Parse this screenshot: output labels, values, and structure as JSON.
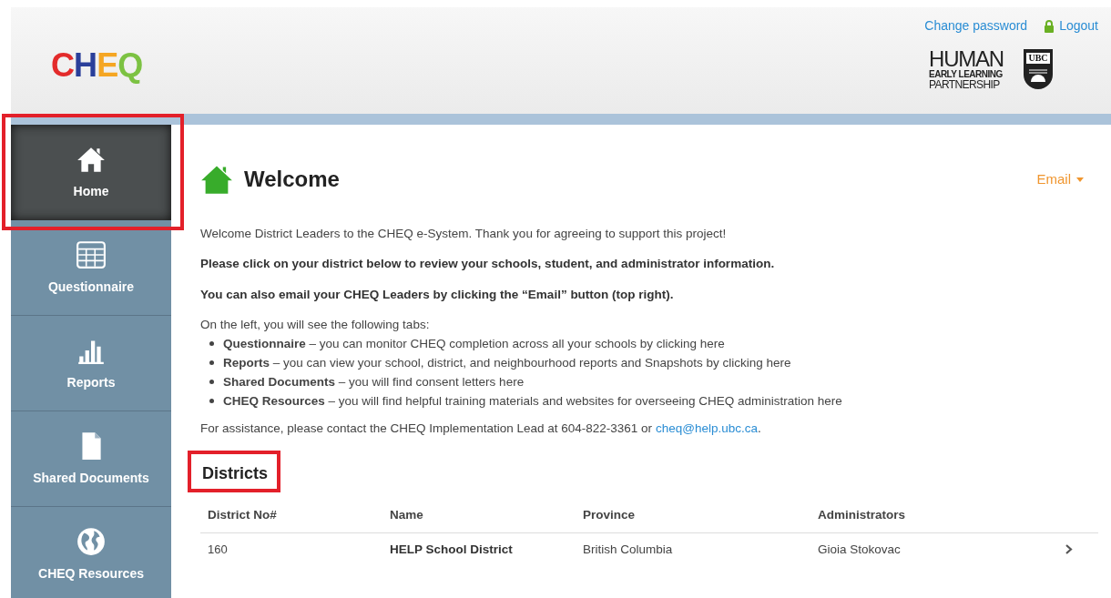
{
  "header": {
    "logo": [
      {
        "text": "C",
        "color": "#e32b2b"
      },
      {
        "text": "H",
        "color": "#2a3f9a"
      },
      {
        "text": "E",
        "color": "#f5a623"
      },
      {
        "text": "Q",
        "color": "#7cc242"
      }
    ],
    "links": [
      {
        "kind": "plain",
        "text": "Change password"
      },
      {
        "kind": "lock",
        "text": "Logout"
      }
    ],
    "partner_logo": [
      "HUMAN",
      "EARLY LEARNING",
      "PARTNERSHIP"
    ],
    "crest": "UBC"
  },
  "sidebar": {
    "items": [
      {
        "kind": "home",
        "label": "Home",
        "selected": true
      },
      {
        "kind": "table",
        "label": "Questionnaire",
        "selected": false
      },
      {
        "kind": "chart",
        "label": "Reports",
        "selected": false
      },
      {
        "kind": "document",
        "label": "Shared Documents",
        "selected": false
      },
      {
        "kind": "globe",
        "label": "CHEQ Resources",
        "selected": false
      }
    ]
  },
  "main": {
    "title": "Welcome",
    "email_button": "Email",
    "paragraphs": [
      {
        "kind": "plain",
        "text": "Welcome District Leaders to the CHEQ e-System. Thank you for agreeing to support this project!"
      },
      {
        "kind": "bold",
        "text": "Please click on your district below to review your schools, student, and administrator information."
      },
      {
        "kind": "bold",
        "text": "You can also email your CHEQ Leaders by clicking the “Email” button (top right)."
      }
    ],
    "tabs_intro": "On the left, you will see the following tabs:",
    "bullets": [
      "**Questionnaire** – you can monitor CHEQ completion across all your schools by clicking here",
      "**Reports** – you can view your school, district, and neighbourhood reports and Snapshots by clicking here",
      "**Shared Documents** – you will find consent letters here",
      "**CHEQ Resources** – you will find helpful training materials and websites for overseeing CHEQ administration here"
    ],
    "contact": {
      "text": "For assistance, please contact the CHEQ Implementation Lead at 604-822-3361 or",
      "link": "cheq@help.ubc.ca",
      "end": "."
    },
    "districts": {
      "title": "Districts",
      "columns": [
        "District No#",
        "Name",
        "Province",
        "Administrators"
      ],
      "rows": [
        [
          "160",
          "HELP School District",
          "British Columbia",
          "Gioia Stokovac"
        ]
      ]
    }
  }
}
